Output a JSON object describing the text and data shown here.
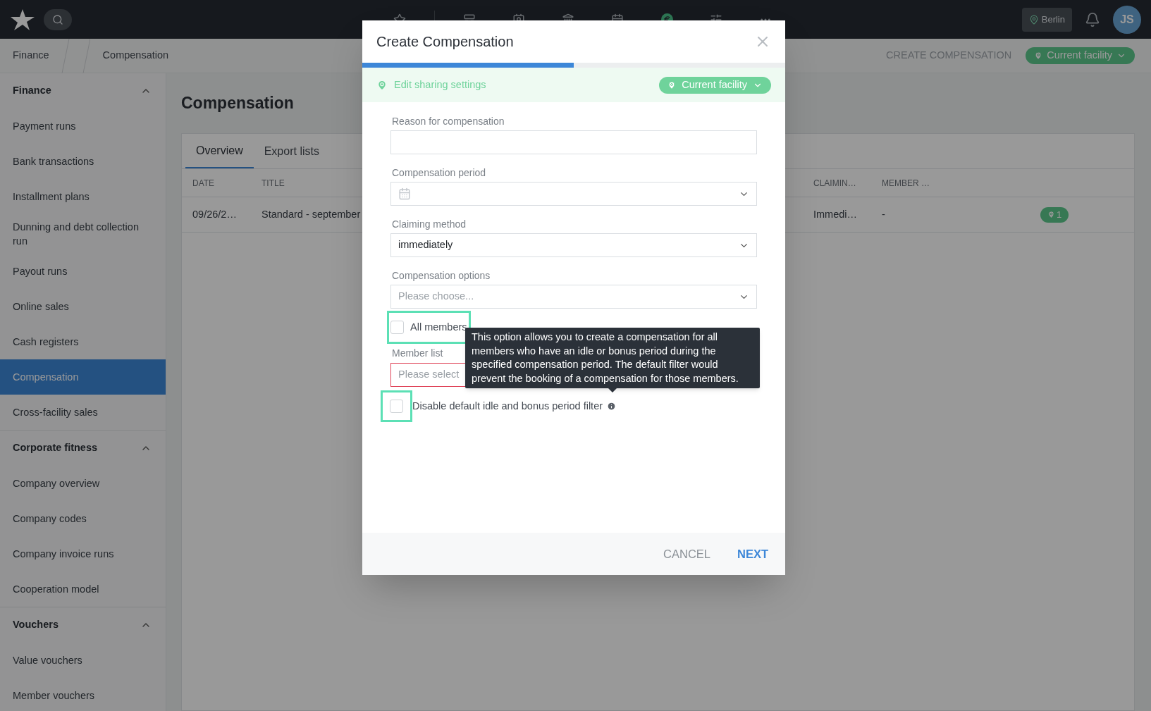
{
  "top_bar": {
    "nav_icons": [
      {
        "kind": "star",
        "selected": false
      },
      {
        "kind": "layout",
        "selected": false
      },
      {
        "kind": "contact",
        "selected": false
      },
      {
        "kind": "register",
        "selected": false
      },
      {
        "kind": "calendar",
        "selected": false
      },
      {
        "kind": "euro",
        "selected": true
      },
      {
        "kind": "sliders",
        "selected": false
      },
      {
        "kind": "more",
        "selected": false
      }
    ],
    "location": "Berlin",
    "avatar_initials": "JS"
  },
  "breadcrumb": [
    "Finance",
    "Compensation"
  ],
  "header_actions": {
    "create_button": "CREATE COMPENSATION",
    "facility_button": "Current facility"
  },
  "sidebar": {
    "sections": [
      {
        "title": "Finance",
        "expanded": true,
        "items": [
          {
            "label": "Payment runs",
            "selected": false
          },
          {
            "label": "Bank transactions",
            "selected": false
          },
          {
            "label": "Installment plans",
            "selected": false
          },
          {
            "label": "Dunning and debt collection run",
            "selected": false
          },
          {
            "label": "Payout runs",
            "selected": false
          },
          {
            "label": "Online sales",
            "selected": false
          },
          {
            "label": "Cash registers",
            "selected": false
          },
          {
            "label": "Compensation",
            "selected": true
          },
          {
            "label": "Cross-facility sales",
            "selected": false
          }
        ]
      },
      {
        "title": "Corporate fitness",
        "expanded": true,
        "items": [
          {
            "label": "Company overview",
            "selected": false
          },
          {
            "label": "Company codes",
            "selected": false
          },
          {
            "label": "Company invoice runs",
            "selected": false
          },
          {
            "label": "Cooperation model",
            "selected": false
          }
        ]
      },
      {
        "title": "Vouchers",
        "expanded": true,
        "items": [
          {
            "label": "Value vouchers",
            "selected": false
          },
          {
            "label": "Member vouchers",
            "selected": false
          }
        ]
      }
    ]
  },
  "page": {
    "title": "Compensation",
    "tabs": [
      {
        "label": "Overview",
        "selected": true
      },
      {
        "label": "Export lists",
        "selected": false
      }
    ],
    "table": {
      "columns": [
        "DATE",
        "TITLE",
        "CLAIMIN…",
        "MEMBER …"
      ],
      "rows": [
        {
          "cells": [
            "09/26/2…",
            "Standard - september",
            "Immedi…",
            "-"
          ],
          "badge": "1"
        }
      ]
    }
  },
  "dialog": {
    "title": "Create Compensation",
    "progress": {
      "level": 0.5
    },
    "sharing": {
      "link": "Edit sharing settings",
      "button": "Current facility"
    },
    "fields": [
      {
        "kind": "text",
        "label": "Reason for compensation"
      },
      {
        "kind": "date",
        "label": "Compensation period"
      },
      {
        "kind": "select",
        "label": "Claiming method",
        "value": "immediately"
      },
      {
        "kind": "select",
        "label": "Compensation options",
        "placeholder": "Please choose..."
      }
    ],
    "all_members": {
      "label": "All members",
      "checked": false,
      "highlighted": true
    },
    "member_list": {
      "label": "Member list",
      "placeholder": "Please select",
      "invalid": true
    },
    "disable_filter": {
      "label": "Disable default idle and bonus period filter",
      "checked": false,
      "highlighted": true
    },
    "tooltip": "This option allows you to create a compensation for all members who have an idle or bonus period during the specified compensation period. The default filter would prevent the booking of a compensation for those members.",
    "buttons": [
      {
        "label": "CANCEL",
        "kind": "secondary"
      },
      {
        "label": "NEXT",
        "kind": "primary"
      }
    ]
  }
}
